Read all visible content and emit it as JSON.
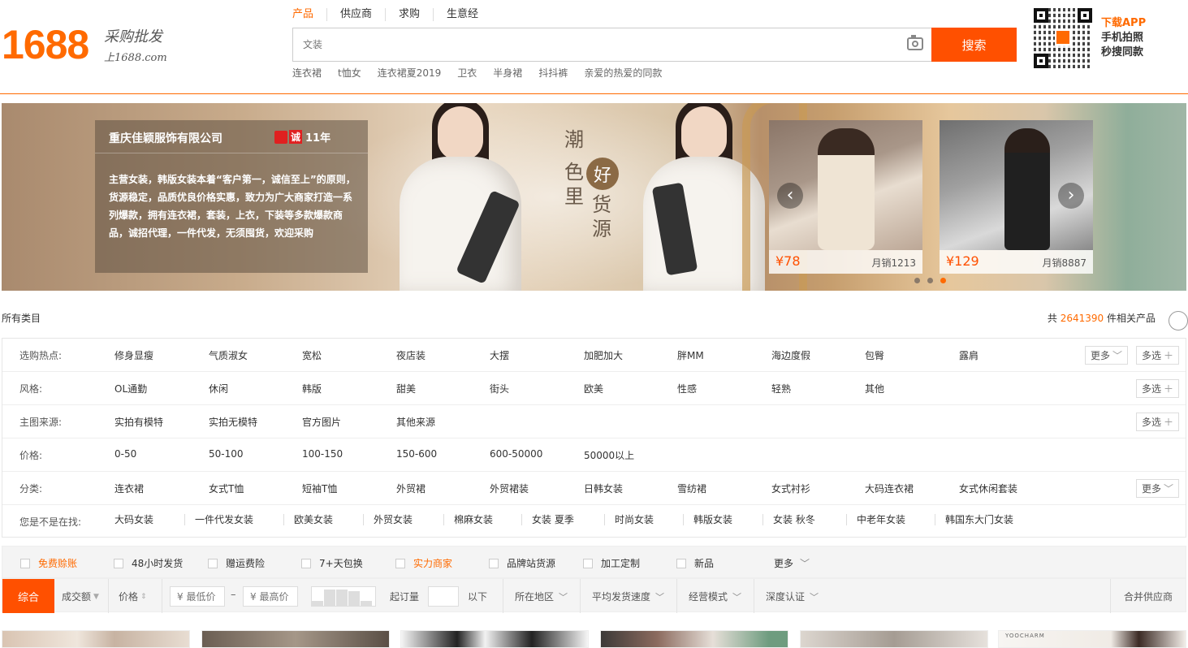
{
  "header": {
    "logo_number": "1688",
    "logo_slogan": "采购批发",
    "logo_site": "上1688.com",
    "search_tabs": [
      "产品",
      "供应商",
      "求购",
      "生意经"
    ],
    "active_tab_index": 0,
    "search_placeholder": "文装",
    "search_button": "搜索",
    "hot_words": [
      "连衣裙",
      "t恤女",
      "连衣裙夏2019",
      "卫衣",
      "半身裙",
      "抖抖裤",
      "亲爱的热爱的同款"
    ],
    "app_title": "下载APP",
    "app_line2": "手机拍照",
    "app_line3": "秒搜同款"
  },
  "banner": {
    "company_name": "重庆佳颖服饰有限公司",
    "cert_char": "诚",
    "cert_years": "11年",
    "company_desc": "主营女装，韩版女装本着“客户第一，诚信至上”的原则，货源稳定，品质优良价格实惠，致力为广大商家打造一系列爆款，拥有连衣裙，套装，上衣，下装等多款爆款商品，诚招代理，一件代发，无须囤货，欢迎采购",
    "slogan_col1": "潮",
    "slogan_col2": "色里",
    "slogan_ring": "好",
    "slogan_col3": "货源",
    "products": [
      {
        "price": "¥78",
        "sales": "月销1213"
      },
      {
        "price": "¥129",
        "sales": "月销8887"
      }
    ],
    "dot_count": 3,
    "active_dot": 2
  },
  "category": {
    "all_label": "所有类目",
    "total_prefix": "共",
    "total_count": "2641390",
    "total_suffix": "件相关产品"
  },
  "filters": {
    "rows": [
      {
        "label": "选购热点:",
        "options": [
          "修身显瘦",
          "气质淑女",
          "宽松",
          "夜店装",
          "大摆",
          "加肥加大",
          "胖MM",
          "海边度假",
          "包臀",
          "露肩"
        ],
        "more": "更多",
        "multi": "多选"
      },
      {
        "label": "风格:",
        "options": [
          "OL通勤",
          "休闲",
          "韩版",
          "甜美",
          "街头",
          "欧美",
          "性感",
          "轻熟",
          "其他"
        ],
        "multi": "多选"
      },
      {
        "label": "主图来源:",
        "options": [
          "实拍有模特",
          "实拍无模特",
          "官方图片",
          "其他来源"
        ],
        "multi": "多选"
      },
      {
        "label": "价格:",
        "options": [
          "0-50",
          "50-100",
          "100-150",
          "150-600",
          "600-50000",
          "50000以上"
        ]
      },
      {
        "label": "分类:",
        "options": [
          "连衣裙",
          "女式T恤",
          "短袖T恤",
          "外贸裙",
          "外贸裙装",
          "日韩女装",
          "雪纺裙",
          "女式衬衫",
          "大码连衣裙",
          "女式休闲套装"
        ],
        "more": "更多"
      }
    ],
    "did_you_mean_label": "您是不是在找:",
    "did_you_mean": [
      "大码女装",
      "一件代发女装",
      "欧美女装",
      "外贸女装",
      "棉麻女装",
      "女装 夏季",
      "时尚女装",
      "韩版女装",
      "女装 秋冬",
      "中老年女装",
      "韩国东大门女装"
    ]
  },
  "features": {
    "items": [
      "免费赊账",
      "48小时发货",
      "赠运费险",
      "7+天包换",
      "实力商家",
      "品牌站货源",
      "加工定制",
      "新品"
    ],
    "orange_indices": [
      0,
      4
    ],
    "more": "更多"
  },
  "sort": {
    "active": "综合",
    "turnover": "成交额",
    "price": "价格",
    "min_price_placeholder": "¥ 最低价",
    "max_price_placeholder": "¥ 最高价",
    "moq_label": "起订量",
    "moq_suffix": "以下",
    "dropdowns": [
      "所在地区",
      "平均发货速度",
      "经营模式",
      "深度认证"
    ],
    "merge": "合并供应商"
  },
  "thumb_brand": "YOOCHARM",
  "colors": {
    "brand_orange": "#ff6a00",
    "button_orange": "#ff5000"
  }
}
